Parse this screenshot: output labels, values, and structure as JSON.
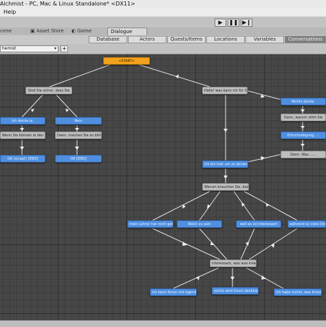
{
  "window": {
    "title": "Alchmist - PC, Mac & Linux Standalone* <DX11>"
  },
  "menu": {
    "help": "Help"
  },
  "toolbar": {
    "play_icon": "play-icon",
    "pause_icon": "pause-icon",
    "step_icon": "step-icon"
  },
  "window_tabs": {
    "scene": "cene",
    "asset_store": "Asset Store",
    "game": "Game",
    "dialogue": "Dialogue"
  },
  "dialogue_tabs": [
    "Database",
    "Actors",
    "Quests/Items",
    "Locations",
    "Variables",
    "Conversations"
  ],
  "conversation_select": {
    "value": "hemist"
  },
  "add_button": {
    "label": "+"
  },
  "nodes": {
    "start": "<START>",
    "n_sind": "Sind Sie sicher, dass Sie",
    "n_hallo": "Hallo! was kann ich für Si",
    "n_ich_denke": "Ich denke ja.",
    "n_nein": "Nein",
    "n_wenn": "Wenn Sie können ei den Ure",
    "n_dann_machen": "Dann, machen Sie es bitte",
    "n_ok_schritt": "OK (scrapt) [END]",
    "n_ok_end": "OK [END]",
    "n_nichts_danke": "Nichts danke.",
    "n_dann_warum": "Dann, warum  stört Sie",
    "n_entschuldigung": "Entschuldigung, ...",
    "n_dann_was": "Dann, Was.......",
    "n_ich_bin_hier": "Ich bin hier um zu lernen.",
    "n_warum": "Warum brauchen Sie, dass z",
    "n_mein_lehrer": "mein Lehrer hat mich gebet",
    "n_reich": "Reich zu sein",
    "n_weil": "weil es ist interessant",
    "n_waehrend": "während so viele Dinge",
    "n_interessant": "interessant, was was krieg",
    "n_ich_kann": "Ich kann Ihnen mit irgende",
    "n_nichts_wird": "nichts wird Ihnen dankbar",
    "n_ich_habe": "Ich habe nichts, was Ihnen"
  }
}
